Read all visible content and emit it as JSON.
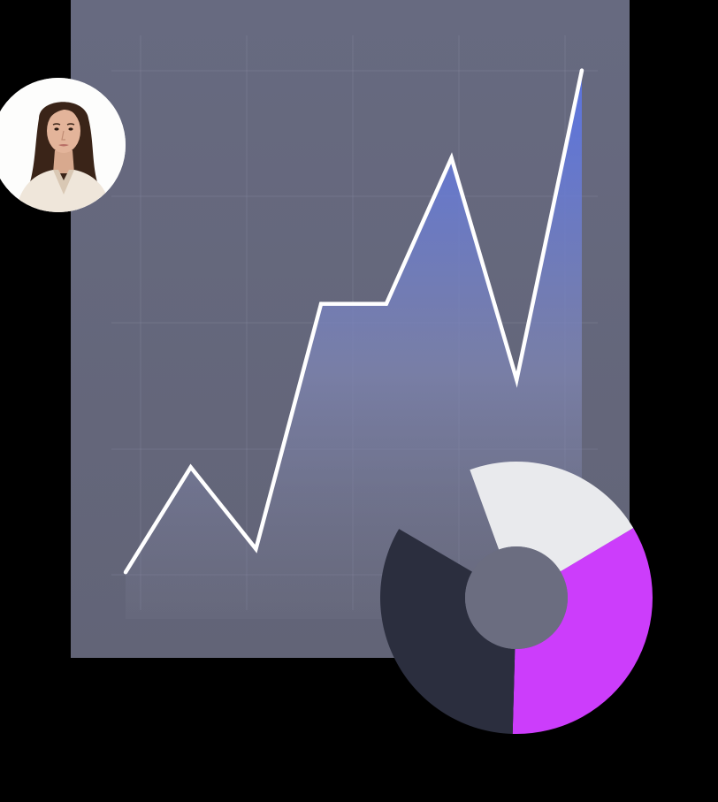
{
  "colors": {
    "background": "#000000",
    "panel": "#646679",
    "grid": "#8a8da3",
    "line": "#ffffff",
    "area_top": "#5a74e6",
    "area_bottom": "#7b7d93",
    "donut_hole": "#6b6d80"
  },
  "avatar": {
    "icon": "person-portrait-icon",
    "ring_color": "#ffffff"
  },
  "chart_data": [
    {
      "type": "area",
      "title": "",
      "xlabel": "",
      "ylabel": "",
      "grid": true,
      "legend": "none",
      "x": [
        0,
        1,
        2,
        3,
        4,
        5,
        6,
        7
      ],
      "values": [
        8,
        26,
        12,
        54,
        54,
        79,
        41,
        94
      ],
      "ylim": [
        0,
        100
      ]
    },
    {
      "type": "pie",
      "style": "donut",
      "segments": [
        {
          "value": 22,
          "color": "#e9eaed"
        },
        {
          "value": 34,
          "color": "#cc3dfb"
        },
        {
          "value": 33,
          "color": "#2b2e3e"
        }
      ],
      "total": 100
    }
  ]
}
